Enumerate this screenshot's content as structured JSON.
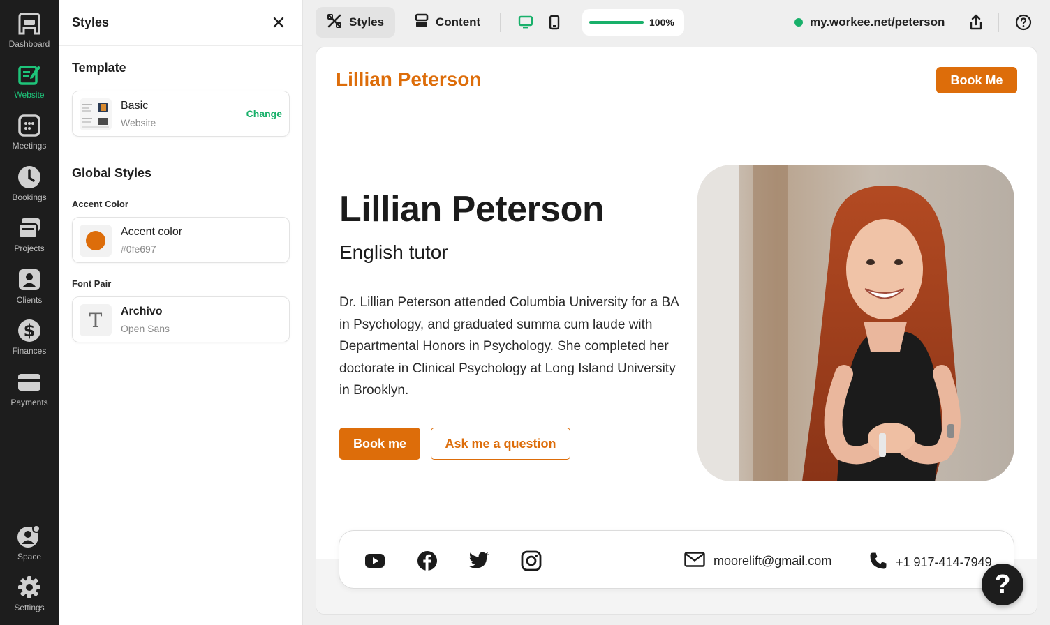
{
  "nav": {
    "items": [
      {
        "label": "Dashboard",
        "icon": "dashboard-icon"
      },
      {
        "label": "Website",
        "icon": "website-edit-icon",
        "active": true
      },
      {
        "label": "Meetings",
        "icon": "meetings-icon"
      },
      {
        "label": "Bookings",
        "icon": "clock-icon"
      },
      {
        "label": "Projects",
        "icon": "projects-icon"
      },
      {
        "label": "Clients",
        "icon": "client-icon"
      },
      {
        "label": "Finances",
        "icon": "dollar-icon"
      },
      {
        "label": "Payments",
        "icon": "card-icon"
      }
    ],
    "bottom": [
      {
        "label": "Space",
        "icon": "space-icon"
      },
      {
        "label": "Settings",
        "icon": "gear-icon"
      }
    ],
    "active_color": "#1ec47a"
  },
  "panel": {
    "title": "Styles",
    "template_heading": "Template",
    "template": {
      "name": "Basic",
      "type": "Website",
      "change_label": "Change"
    },
    "global_heading": "Global Styles",
    "accent_label": "Accent Color",
    "accent": {
      "name": "Accent color",
      "value": "#0fe697",
      "swatch": "#dd6d0a"
    },
    "font_label": "Font Pair",
    "font": {
      "glyph": "T",
      "heading_font": "Archivo",
      "body_font": "Open Sans"
    }
  },
  "toolbar": {
    "styles_label": "Styles",
    "content_label": "Content",
    "zoom_percent": 100,
    "zoom_label": "100%",
    "url": "my.workee.net/peterson"
  },
  "site": {
    "brand": "Lillian Peterson",
    "book_header": "Book Me",
    "name": "Lillian Peterson",
    "role": "English tutor",
    "bio": "Dr. Lillian Peterson attended Columbia University for a BA in Psychology, and graduated summa cum laude with Departmental Honors in Psychology. She completed her doctorate in Clinical Psychology at Long Island University in Brooklyn.",
    "book_button": "Book me",
    "ask_button": "Ask me a question",
    "accent": "#dd6d0a",
    "email": "moorelift@gmail.com",
    "phone": "+1 917-414-7949",
    "socials": [
      "youtube-icon",
      "facebook-icon",
      "twitter-icon",
      "instagram-icon"
    ]
  },
  "help_label": "?"
}
